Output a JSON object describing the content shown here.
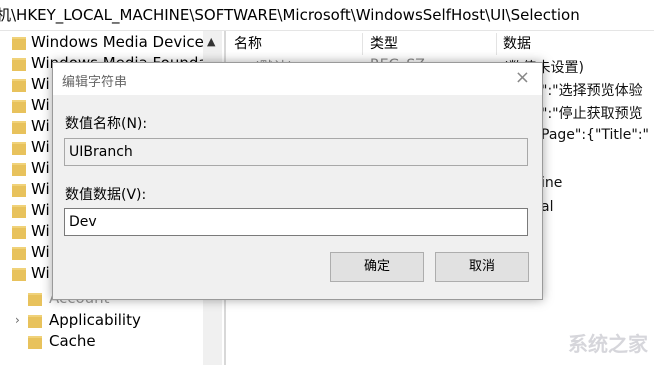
{
  "address": "机\\HKEY_LOCAL_MACHINE\\SOFTWARE\\Microsoft\\WindowsSelfHost\\UI\\Selection",
  "tree": {
    "items": [
      {
        "label": "Windows Media Device M"
      },
      {
        "label": "Windows Media Foundatio"
      },
      {
        "label": "Wi"
      },
      {
        "label": "Wi"
      },
      {
        "label": "Wi"
      },
      {
        "label": "Wi"
      },
      {
        "label": "Wi"
      },
      {
        "label": "Wi"
      },
      {
        "label": "Wi"
      },
      {
        "label": "Wi"
      },
      {
        "label": "Wi"
      },
      {
        "label": "Wi"
      }
    ],
    "sub": [
      {
        "label": "Account"
      },
      {
        "label": "Applicability"
      },
      {
        "label": "Cache"
      }
    ]
  },
  "columns": {
    "name": "名称",
    "type": "类型",
    "data": "数据"
  },
  "right_fragments": {
    "r1": "(默认)",
    "r1type": "REG_SZ",
    "r1data": "(数值未设置)",
    "r2": "\":\"选择预览体验",
    "r3": "\":\"停止获取预览",
    "r4": "Page\":{\"Title\":\"",
    "r5": "ine",
    "r6": "al"
  },
  "dialog": {
    "title": "编辑字符串",
    "name_label": "数值名称(N):",
    "name_value": "UIBranch",
    "data_label": "数值数据(V):",
    "data_value": "Dev",
    "ok": "确定",
    "cancel": "取消",
    "close_icon": "×"
  },
  "watermark": "系统之家"
}
